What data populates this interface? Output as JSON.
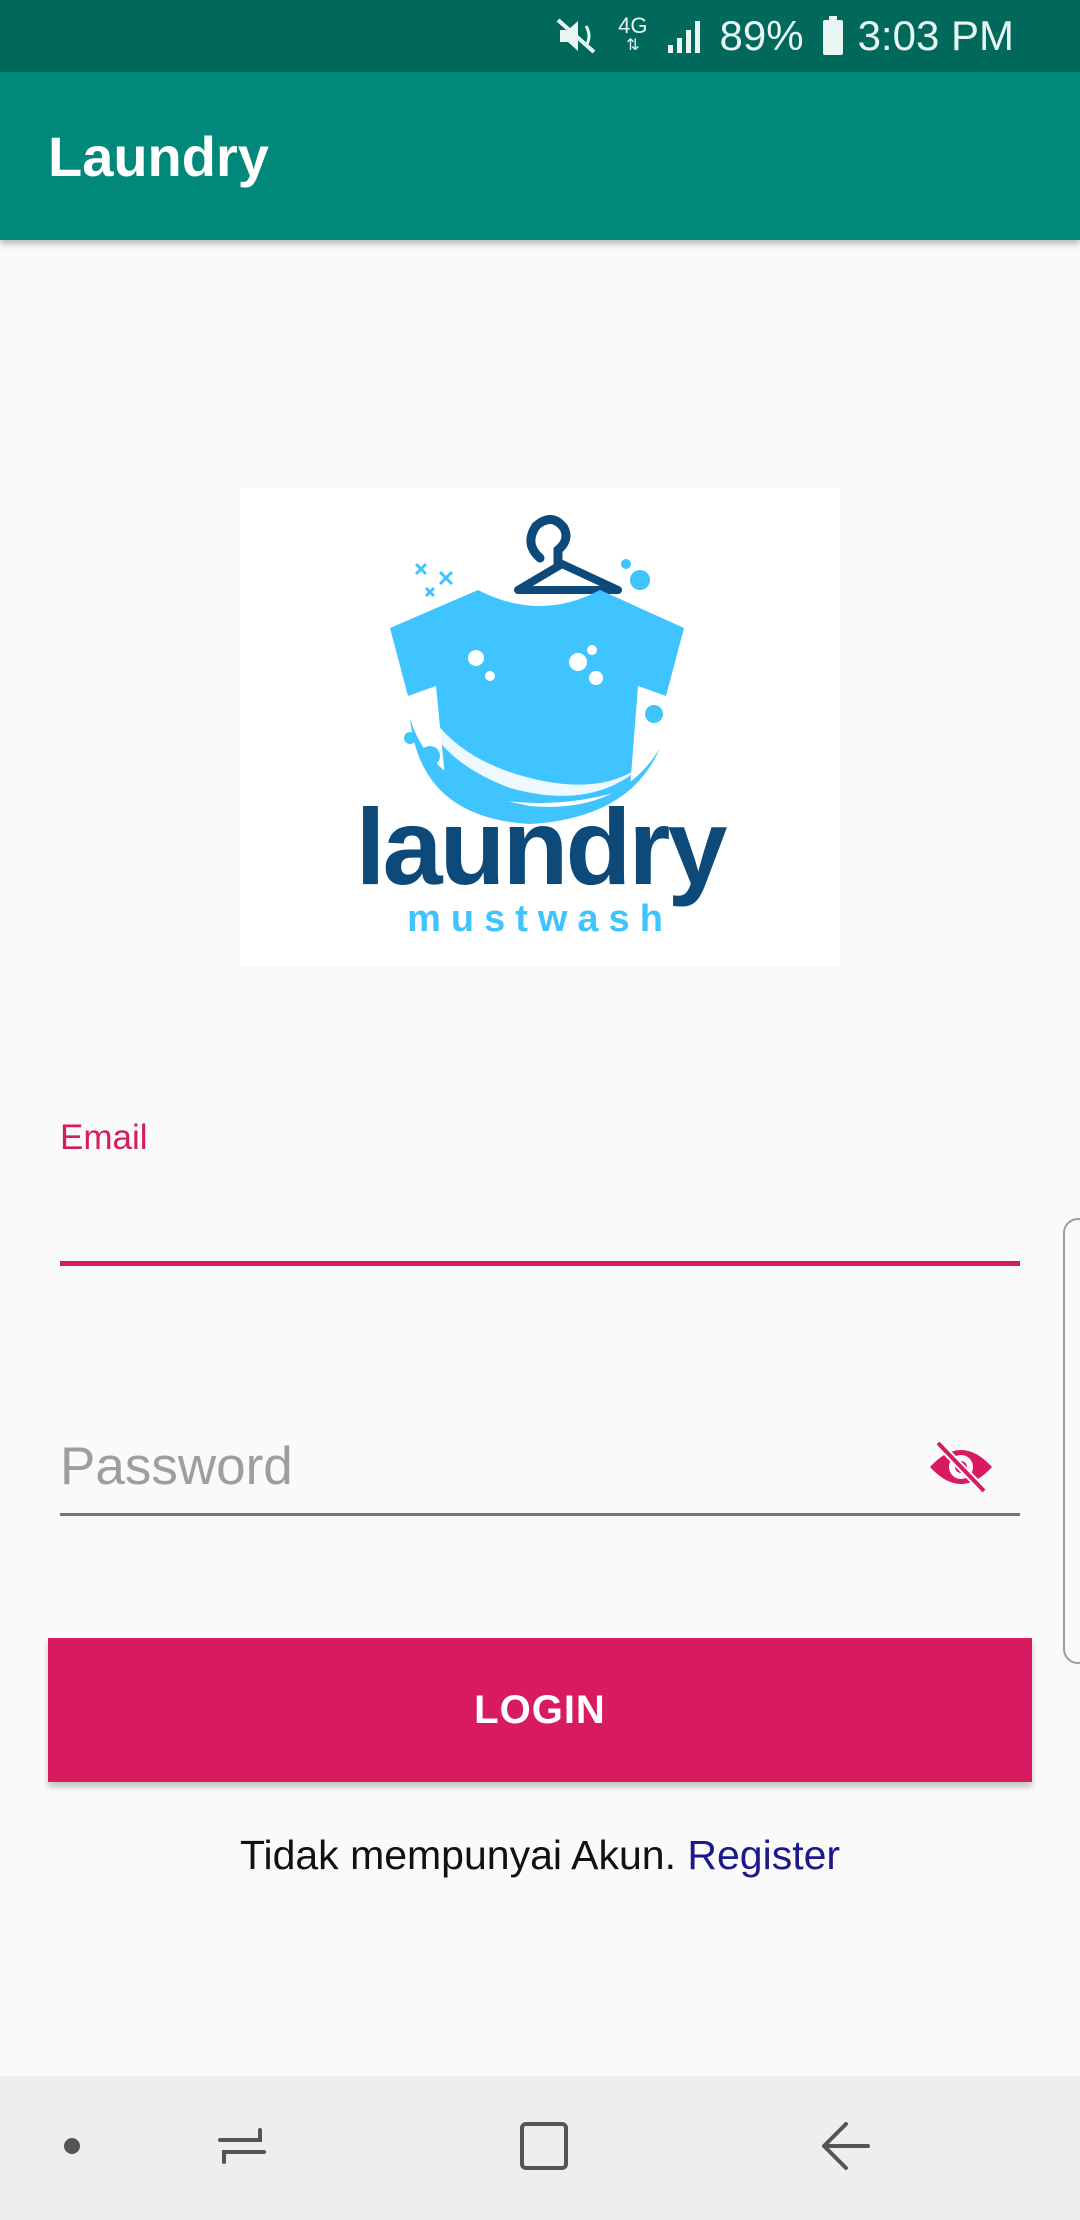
{
  "status_bar": {
    "battery": "89%",
    "time": "3:03 PM",
    "network_type": "4G",
    "icons": [
      "mute-icon",
      "network-4g-icon",
      "signal-icon",
      "battery-icon"
    ]
  },
  "app_bar": {
    "title": "Laundry"
  },
  "logo": {
    "word": "laundry",
    "tagline": "mustwash"
  },
  "form": {
    "email_label": "Email",
    "email_value": "",
    "password_placeholder": "Password",
    "password_value": "",
    "login_label": "LOGIN"
  },
  "register": {
    "prompt": "Tidak mempunyai Akun.",
    "link": "Register"
  },
  "nav_bar": {
    "buttons": [
      "dot-icon",
      "recent-apps-icon",
      "home-icon",
      "back-icon"
    ]
  },
  "colors": {
    "status_bar": "#00695c",
    "app_bar": "#00897b",
    "accent": "#d81b60",
    "link": "#1a1a8c",
    "logo_blue": "#40c4ff",
    "logo_navy": "#0d4a7a"
  }
}
